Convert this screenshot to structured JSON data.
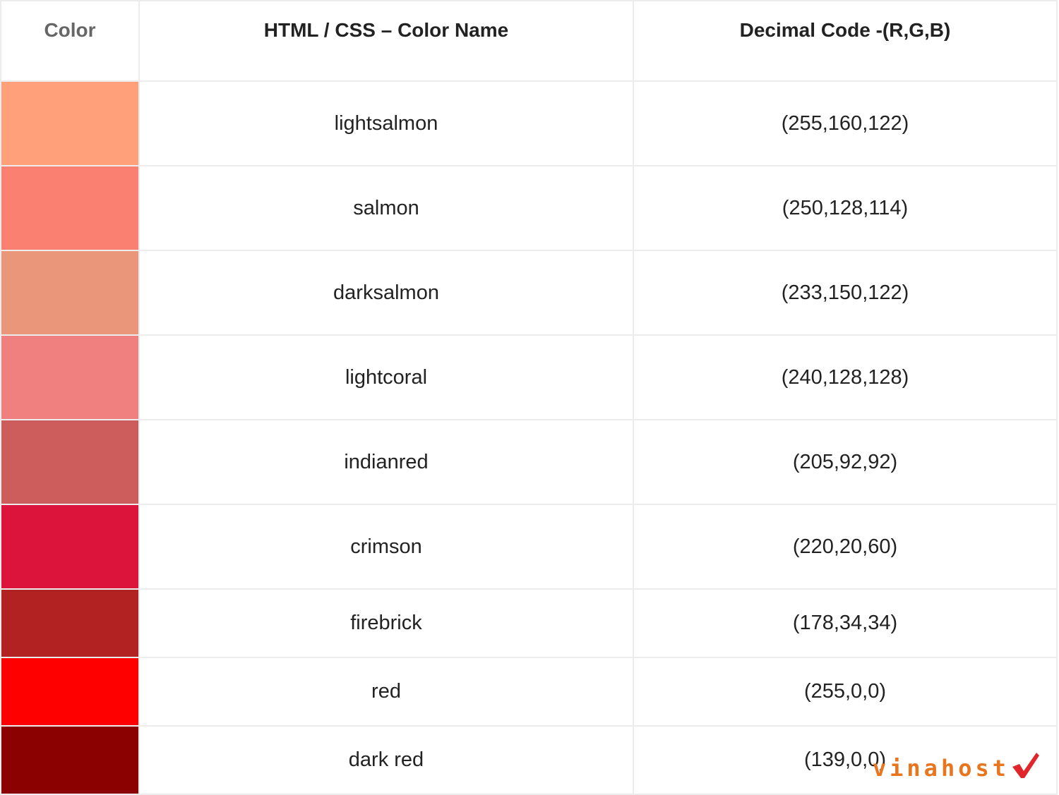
{
  "table": {
    "headers": {
      "color": "Color",
      "name": "HTML / CSS – Color Name",
      "code": "Decimal Code -(R,G,B)"
    },
    "rows": [
      {
        "swatch": "#ffa07a",
        "name": "lightsalmon",
        "code": "(255,160,122)"
      },
      {
        "swatch": "#fa8072",
        "name": "salmon",
        "code": "(250,128,114)"
      },
      {
        "swatch": "#e9967a",
        "name": "darksalmon",
        "code": "(233,150,122)"
      },
      {
        "swatch": "#f08080",
        "name": "lightcoral",
        "code": "(240,128,128)"
      },
      {
        "swatch": "#cd5c5c",
        "name": "indianred",
        "code": "(205,92,92)"
      },
      {
        "swatch": "#dc143c",
        "name": "crimson",
        "code": "(220,20,60)"
      },
      {
        "swatch": "#b22222",
        "name": "firebrick",
        "code": "(178,34,34)"
      },
      {
        "swatch": "#ff0000",
        "name": "red",
        "code": "(255,0,0)"
      },
      {
        "swatch": "#8b0000",
        "name": "dark red",
        "code": "(139,0,0)"
      }
    ]
  },
  "watermark": {
    "text": "vinahost",
    "color": "#e8761e",
    "check_color": "#e0262b"
  }
}
